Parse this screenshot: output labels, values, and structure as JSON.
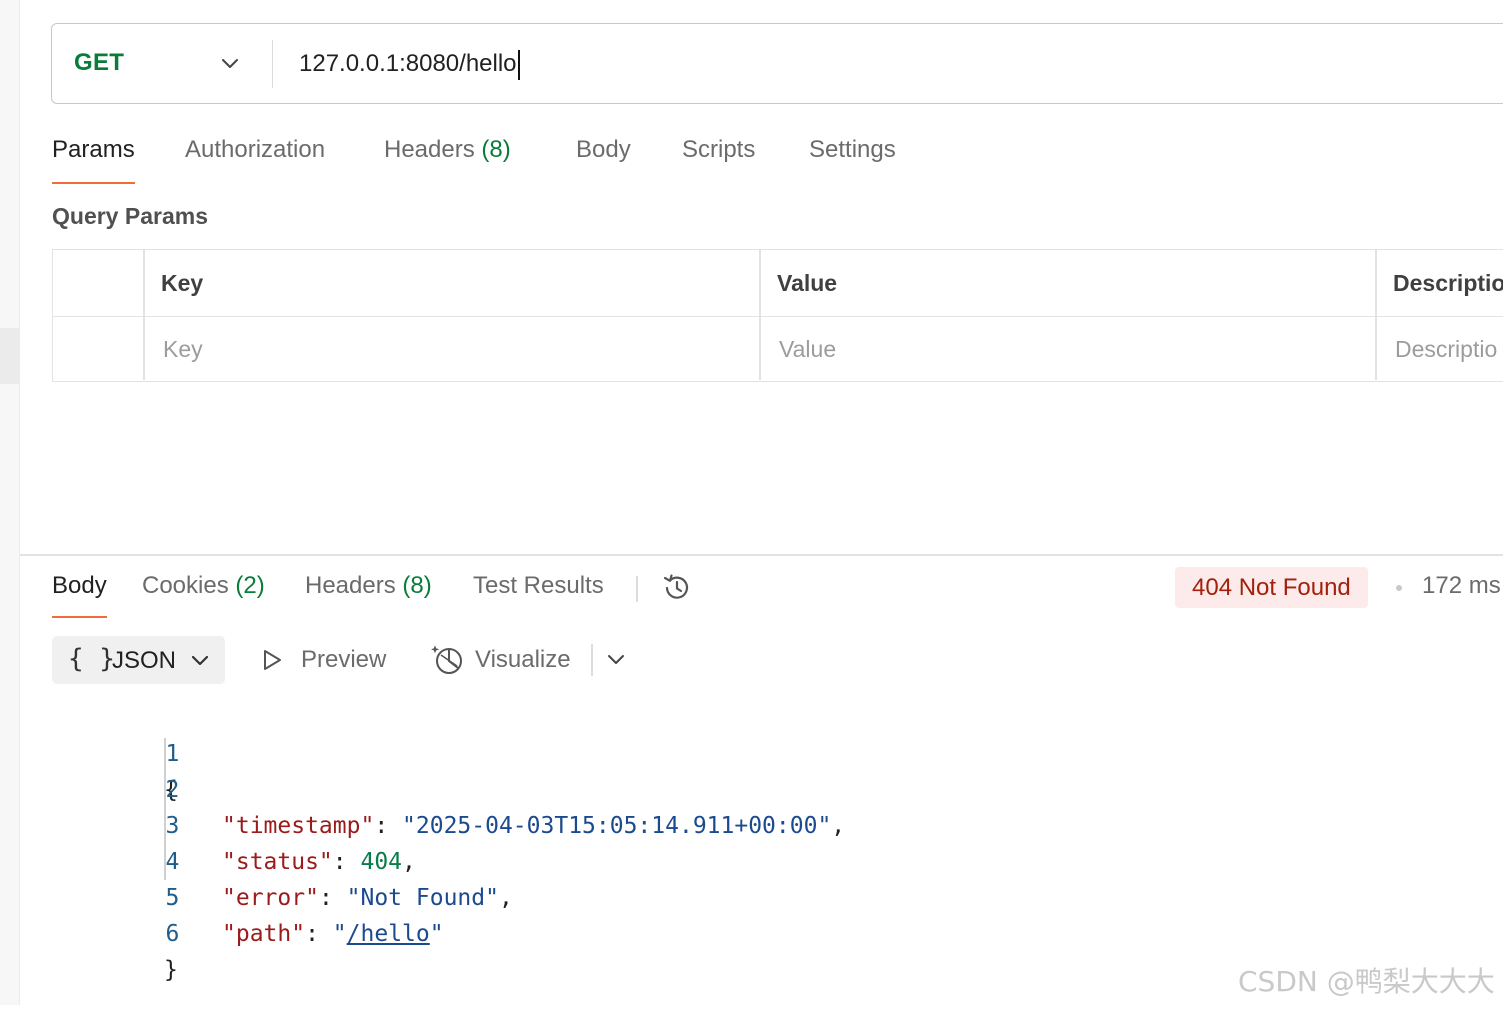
{
  "request": {
    "method": "GET",
    "url": "127.0.0.1:8080/hello"
  },
  "request_tabs": [
    {
      "label": "Params",
      "active": true
    },
    {
      "label": "Authorization"
    },
    {
      "label": "Headers",
      "count": "(8)"
    },
    {
      "label": "Body"
    },
    {
      "label": "Scripts"
    },
    {
      "label": "Settings"
    }
  ],
  "query_params": {
    "title": "Query Params",
    "headers": [
      "Key",
      "Value",
      "Descriptio"
    ],
    "placeholders": [
      "Key",
      "Value",
      "Descriptio"
    ]
  },
  "response_tabs": [
    {
      "label": "Body",
      "active": true
    },
    {
      "label": "Cookies",
      "count": "(2)"
    },
    {
      "label": "Headers",
      "count": "(8)"
    },
    {
      "label": "Test Results"
    }
  ],
  "response_status": {
    "badge": "404 Not Found",
    "time": "172 ms",
    "badge_bg": "#fdeaea",
    "badge_color": "#a3200c"
  },
  "response_toolbar": {
    "format": "JSON",
    "format_icon": "{ }",
    "preview": "Preview",
    "visualize": "Visualize"
  },
  "response_body": {
    "line_numbers": [
      "1",
      "2",
      "3",
      "4",
      "5",
      "6"
    ],
    "open_brace": "{",
    "close_brace": "}",
    "fields": [
      {
        "key": "\"timestamp\"",
        "sep": ": ",
        "value": "\"2025-04-03T15:05:14.911+00:00\"",
        "trail": ","
      },
      {
        "key": "\"status\"",
        "sep": ": ",
        "value": "404",
        "trail": ","
      },
      {
        "key": "\"error\"",
        "sep": ": ",
        "value": "\"Not Found\"",
        "trail": ","
      },
      {
        "key": "\"path\"",
        "sep": ": ",
        "value_q": "\"",
        "value_link": "/hello",
        "value_q2": "\"",
        "trail": ""
      }
    ]
  },
  "watermark": "CSDN @鸭梨大大大",
  "colors": {
    "accent_tab": "#f26b3a",
    "method_green": "#0a7c3a"
  }
}
